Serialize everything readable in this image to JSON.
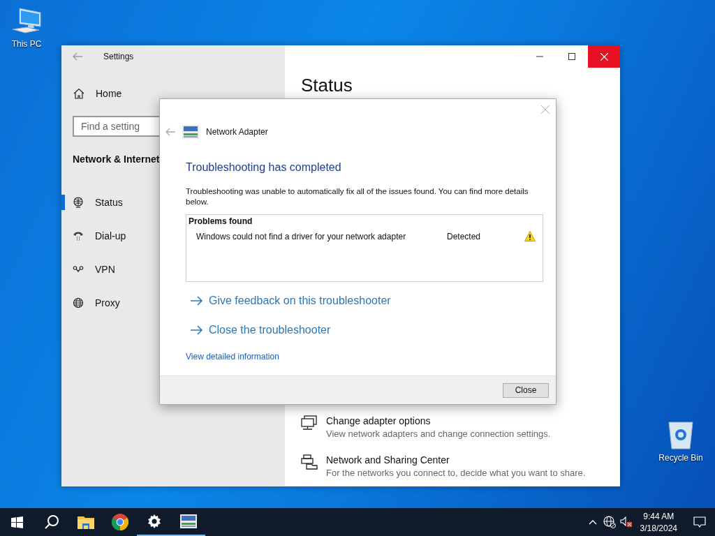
{
  "desktop": {
    "icons": [
      {
        "kind": "computer",
        "label": "This PC"
      },
      {
        "kind": "recycle",
        "label": "Recycle Bin"
      }
    ]
  },
  "settings_window": {
    "title": "Settings",
    "nav": {
      "home": "Home",
      "search": {
        "placeholder": "Find a setting"
      },
      "section": "Network & Internet",
      "items": [
        {
          "kind": "status",
          "label": "Status",
          "selected": true
        },
        {
          "kind": "dialup",
          "label": "Dial-up",
          "selected": false
        },
        {
          "kind": "vpn",
          "label": "VPN",
          "selected": false
        },
        {
          "kind": "proxy",
          "label": "Proxy",
          "selected": false
        }
      ]
    },
    "content": {
      "heading": "Status",
      "links": [
        {
          "kind": "adapter",
          "title": "Change adapter options",
          "subtitle": "View network adapters and change connection settings."
        },
        {
          "kind": "sharing",
          "title": "Network and Sharing Center",
          "subtitle": "For the networks you connect to, decide what you want to share."
        }
      ]
    }
  },
  "dialog": {
    "title": "Network Adapter",
    "heading": "Troubleshooting has completed",
    "message": "Troubleshooting was unable to automatically fix all of the issues found. You can find more details below.",
    "problems": {
      "header": "Problems found",
      "rows": [
        {
          "description": "Windows could not find a driver for your network adapter",
          "status": "Detected",
          "kind": "warning"
        }
      ]
    },
    "actions": [
      "Give feedback on this troubleshooter",
      "Close the troubleshooter"
    ],
    "detail_link": "View detailed information",
    "buttons": [
      "Close"
    ]
  },
  "taskbar": {
    "apps": [
      {
        "kind": "start",
        "active": false
      },
      {
        "kind": "search",
        "active": false
      },
      {
        "kind": "explorer",
        "active": false
      },
      {
        "kind": "chrome",
        "active": false
      },
      {
        "kind": "settings",
        "active": true
      },
      {
        "kind": "troubleshooter",
        "active": true
      }
    ],
    "clock": {
      "time": "9:44 AM",
      "date": "3/18/2024"
    }
  }
}
